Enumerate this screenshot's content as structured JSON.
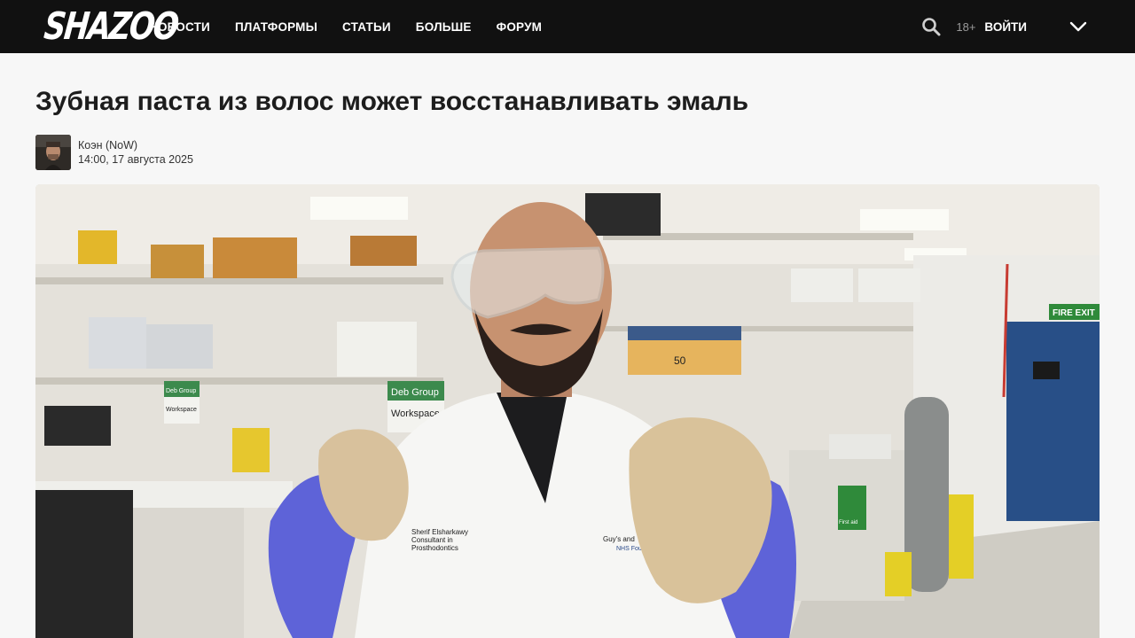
{
  "header": {
    "logo_text": "SHAZOO",
    "nav": [
      {
        "label": "НОВОСТИ"
      },
      {
        "label": "ПЛАТФОРМЫ"
      },
      {
        "label": "СТАТЬИ"
      },
      {
        "label": "БОЛЬШЕ"
      },
      {
        "label": "ФОРУМ"
      }
    ],
    "age_badge": "18+",
    "login_label": "ВОЙТИ",
    "icons": [
      "search-icon",
      "chevron-down-icon"
    ]
  },
  "article": {
    "title": "Зубная паста из волос может восстанавливать эмаль",
    "author_name": "Коэн (NoW)",
    "published": "14:00, 17 августа 2025",
    "hero_signs": {
      "sign_left_line1": "Deb Group",
      "sign_left_line2": "Workspace",
      "sign_right_line1": "Deb Group",
      "sign_right_line2": "Workspace",
      "exit_sign": "FIRE EXIT",
      "first_aid": "First aid",
      "box_label": "50",
      "coat_name_line1": "Sherif Elsharkawy",
      "coat_name_line2": "Consultant in",
      "coat_name_line3": "Prosthodontics",
      "coat_org_line1": "Guy's and",
      "coat_org_line2": "NHS Fou"
    }
  },
  "colors": {
    "topbar_bg": "#111111",
    "page_bg": "#f7f7f7",
    "title_color": "#1d1d1d"
  }
}
